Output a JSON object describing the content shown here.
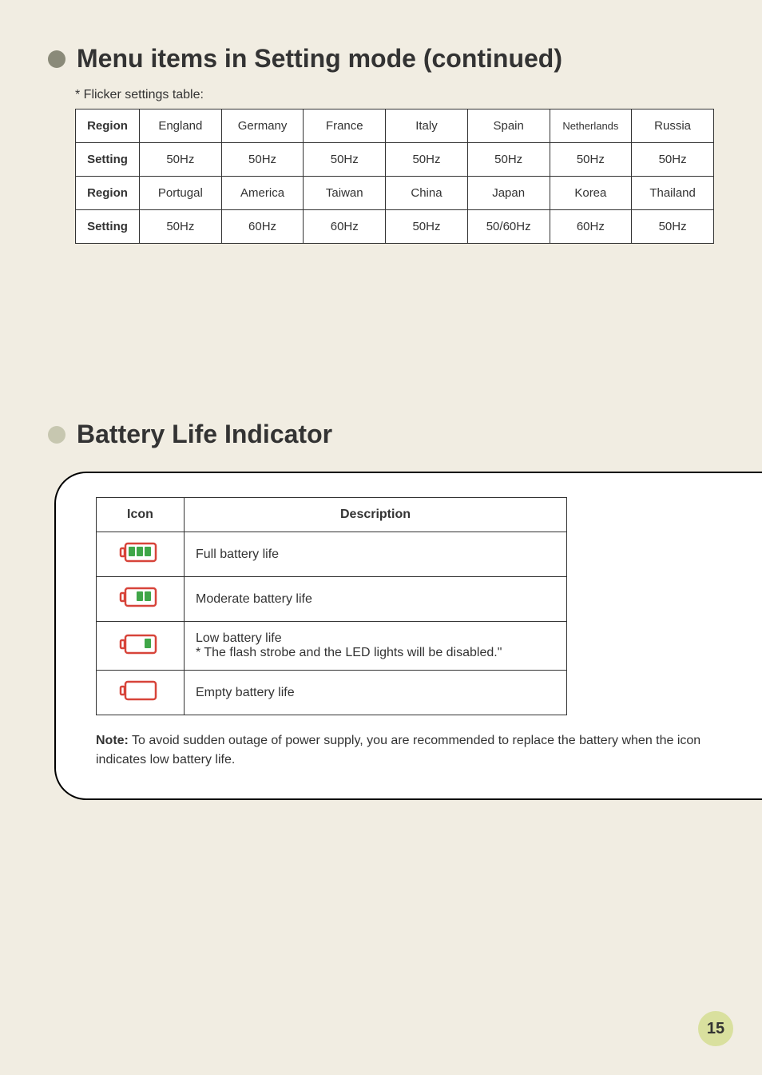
{
  "headings": {
    "h1": "Menu items in Setting mode (continued)",
    "h2": "Battery Life Indicator",
    "flicker_caption": "* Flicker settings table:"
  },
  "flicker": {
    "row_labels": {
      "region": "Region",
      "setting": "Setting"
    },
    "rows": [
      {
        "region": [
          "England",
          "Germany",
          "France",
          "Italy",
          "Spain",
          "Netherlands",
          "Russia"
        ],
        "setting": [
          "50Hz",
          "50Hz",
          "50Hz",
          "50Hz",
          "50Hz",
          "50Hz",
          "50Hz"
        ]
      },
      {
        "region": [
          "Portugal",
          "America",
          "Taiwan",
          "China",
          "Japan",
          "Korea",
          "Thailand"
        ],
        "setting": [
          "50Hz",
          "60Hz",
          "60Hz",
          "50Hz",
          "50/60Hz",
          "60Hz",
          "50Hz"
        ]
      }
    ]
  },
  "battery": {
    "headers": {
      "icon": "Icon",
      "desc": "Description"
    },
    "rows": [
      {
        "level": 3,
        "desc": "Full battery life"
      },
      {
        "level": 2,
        "desc": "Moderate battery life"
      },
      {
        "level": 1,
        "desc": "Low battery life\n* The flash strobe and the LED lights will be disabled.\""
      },
      {
        "level": 0,
        "desc": "Empty battery life"
      }
    ]
  },
  "note": {
    "label": "Note:",
    "text": " To avoid sudden outage of power supply, you are recommended to replace the battery when the icon indicates low battery life."
  },
  "page_number": "15",
  "colors": {
    "green": "#3fa648",
    "red": "#d7443a"
  }
}
